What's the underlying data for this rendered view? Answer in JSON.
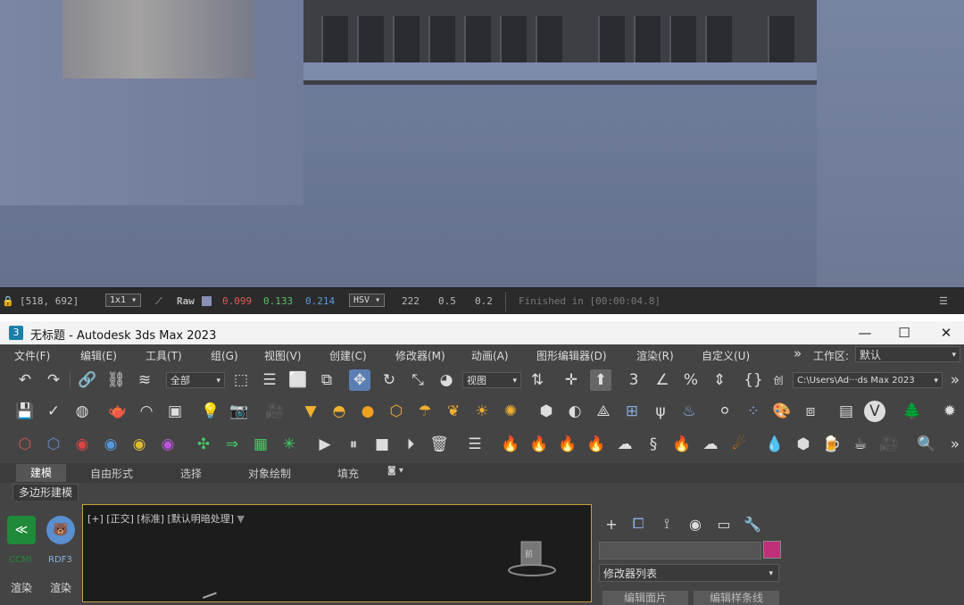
{
  "render_window": {
    "coords": "[518, 692]",
    "zoom": "1x1",
    "raw_label": "Raw",
    "r_value": "0.099",
    "g_value": "0.133",
    "b_value": "0.214",
    "color_mode": "HSV",
    "h_value": "222",
    "s_value": "0.5",
    "v_value": "0.2",
    "status": "Finished in [00:00:04.8]"
  },
  "titlebar": {
    "app_icon_text": "3",
    "title": "无标题 - Autodesk 3ds Max 2023",
    "minimize": "—",
    "maximize": "☐",
    "close": "✕"
  },
  "menubar": {
    "items": [
      "文件(F)",
      "编辑(E)",
      "工具(T)",
      "组(G)",
      "视图(V)",
      "创建(C)",
      "修改器(M)",
      "动画(A)",
      "图形编辑器(D)",
      "渲染(R)",
      "自定义(U)"
    ],
    "more": "»",
    "workspace_label": "工作区:",
    "workspace_value": "默认"
  },
  "toolbar1": {
    "selection_filter": "全部",
    "ref_coord": "视图",
    "path": "C:\\Users\\Ad···ds Max 2023"
  },
  "ribbon": {
    "tabs": [
      "建模",
      "自由形式",
      "选择",
      "对象绘制",
      "填充"
    ],
    "sub_label": "多边形建模"
  },
  "left_panel": {
    "plugin1_label": "CCMI",
    "plugin2_label": "RDF3",
    "render1": "渲染",
    "render2": "渲染"
  },
  "viewport": {
    "label": "[+] [正交] [标准] [默认明暗处理]"
  },
  "command_panel": {
    "modifier_list": "修改器列表",
    "btn1": "编辑面片",
    "btn2": "编辑样条线"
  },
  "colors": {
    "r_color": "#e05a5a",
    "g_color": "#5ac06a",
    "b_color": "#5a9ae0",
    "accent_swatch": "#c0307a",
    "viewport_border": "#c8a03a"
  }
}
